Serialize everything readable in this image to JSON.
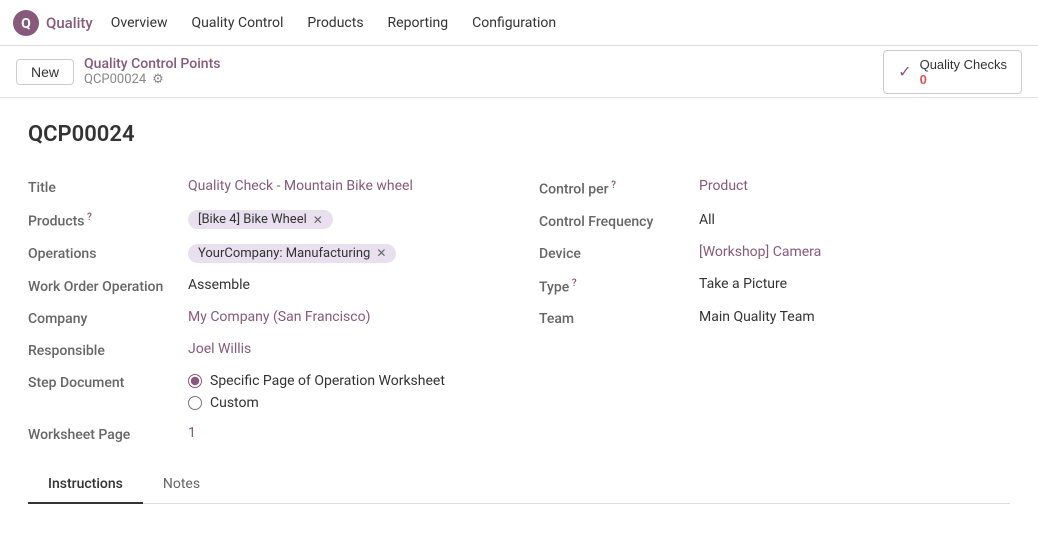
{
  "app": {
    "logo_text": "Q",
    "name": "Quality"
  },
  "nav": {
    "items": [
      {
        "label": "Overview",
        "active": false
      },
      {
        "label": "Quality Control",
        "active": false
      },
      {
        "label": "Products",
        "active": false
      },
      {
        "label": "Reporting",
        "active": false
      },
      {
        "label": "Configuration",
        "active": false
      }
    ]
  },
  "action_bar": {
    "new_label": "New",
    "breadcrumb_title": "Quality Control Points",
    "breadcrumb_sub": "QCP00024",
    "quality_checks_label": "Quality Checks",
    "quality_checks_count": "0"
  },
  "record": {
    "id": "QCP00024",
    "fields": {
      "title_label": "Title",
      "title_value": "Quality Check - Mountain Bike wheel",
      "products_label": "Products",
      "products_tag": "[Bike 4] Bike Wheel",
      "operations_label": "Operations",
      "operations_tag": "YourCompany: Manufacturing",
      "work_order_label": "Work Order Operation",
      "work_order_value": "Assemble",
      "company_label": "Company",
      "company_value": "My Company (San Francisco)",
      "responsible_label": "Responsible",
      "responsible_value": "Joel Willis",
      "step_doc_label": "Step Document",
      "step_doc_option1": "Specific Page of Operation Worksheet",
      "step_doc_option2": "Custom",
      "worksheet_page_label": "Worksheet Page",
      "worksheet_page_value": "1",
      "control_per_label": "Control per",
      "control_per_value": "Product",
      "control_freq_label": "Control Frequency",
      "control_freq_value": "All",
      "device_label": "Device",
      "device_value": "[Workshop] Camera",
      "type_label": "Type",
      "type_value": "Take a Picture",
      "team_label": "Team",
      "team_value": "Main Quality Team"
    }
  },
  "tabs": [
    {
      "label": "Instructions",
      "active": true
    },
    {
      "label": "Notes",
      "active": false
    }
  ]
}
